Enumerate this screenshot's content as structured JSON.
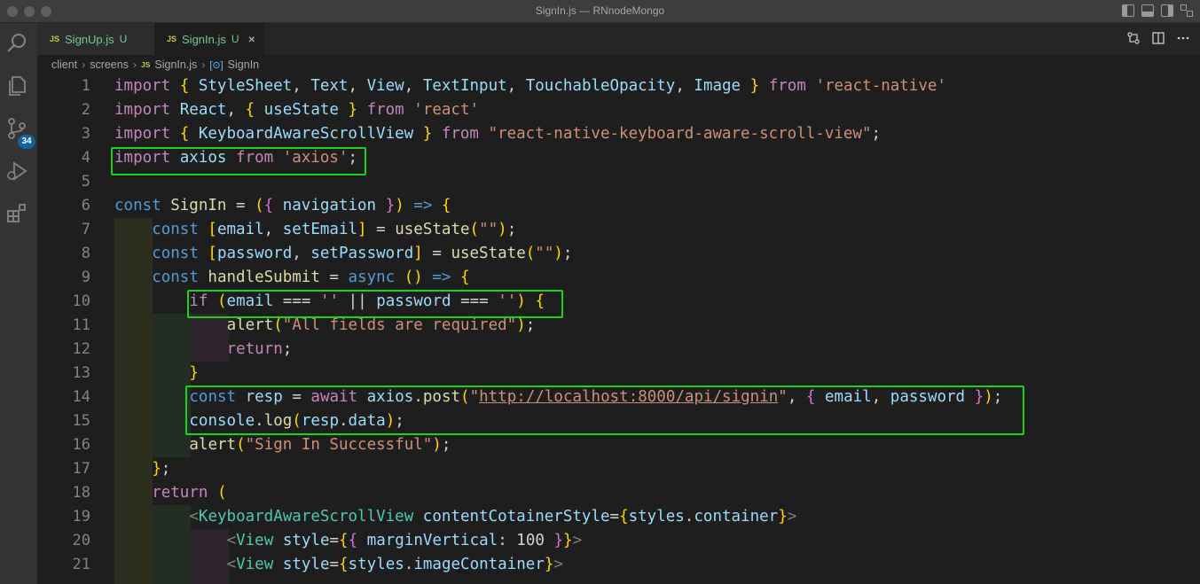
{
  "window": {
    "title": "SignIn.js — RNnodeMongo"
  },
  "activity_bar": {
    "items": [
      {
        "name": "search-icon"
      },
      {
        "name": "explorer-icon"
      },
      {
        "name": "source-control-icon",
        "badge": "34"
      },
      {
        "name": "run-debug-icon"
      },
      {
        "name": "extensions-icon"
      }
    ]
  },
  "tabs": [
    {
      "file_type": "JS",
      "label": "SignUp.js",
      "status": "U",
      "active": false
    },
    {
      "file_type": "JS",
      "label": "SignIn.js",
      "status": "U",
      "active": true,
      "close": "×"
    }
  ],
  "tab_actions": [
    "compare-icon",
    "split-editor-icon",
    "more-actions-icon"
  ],
  "breadcrumb": {
    "items": [
      "client",
      "screens",
      "SignIn.js",
      "SignIn"
    ],
    "file_type": "JS",
    "separator": "›"
  },
  "editor": {
    "line_numbers": [
      "1",
      "2",
      "3",
      "4",
      "5",
      "6",
      "7",
      "8",
      "9",
      "10",
      "11",
      "12",
      "13",
      "14",
      "15",
      "16",
      "17",
      "18",
      "19",
      "20",
      "21"
    ],
    "lines": [
      "import { StyleSheet, Text, View, TextInput, TouchableOpacity, Image } from 'react-native'",
      "import React, { useState } from 'react'",
      "import { KeyboardAwareScrollView } from \"react-native-keyboard-aware-scroll-view\";",
      "import axios from 'axios';",
      "",
      "const SignIn = ({ navigation }) => {",
      "    const [email, setEmail] = useState(\"\");",
      "    const [password, setPassword] = useState(\"\");",
      "    const handleSubmit = async () => {",
      "        if (email === '' || password === '') {",
      "            alert(\"All fields are required\");",
      "            return;",
      "        }",
      "        const resp = await axios.post(\"http://localhost:8000/api/signin\", { email, password });",
      "        console.log(resp.data);",
      "        alert(\"Sign In Successful\");",
      "    };",
      "    return (",
      "        <KeyboardAwareScrollView contentCotainerStyle={styles.container}>",
      "            <View style={{ marginVertical: 100 }}>",
      "            <View style={styles.imageContainer}>"
    ]
  },
  "colors": {
    "highlight_box": "#1dd11d",
    "keyword": "#569cd6",
    "control_keyword": "#c586c0",
    "string": "#ce9178",
    "function": "#dcdcaa",
    "variable": "#9cdcfe",
    "jsx_tag": "#4ec9b0"
  }
}
